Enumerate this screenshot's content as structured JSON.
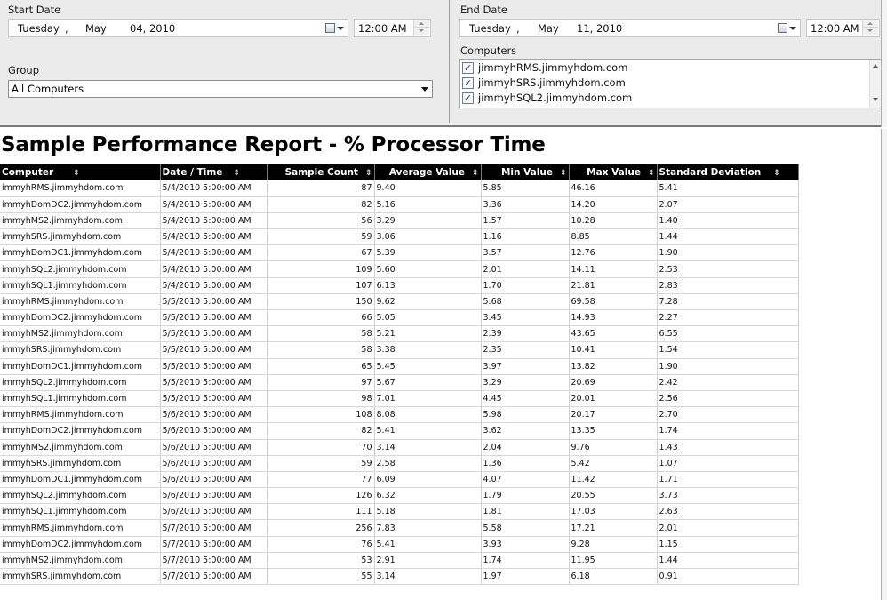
{
  "params": {
    "start_date": {
      "label": "Start Date",
      "day": "Tuesday",
      "sep": ",",
      "month": "May",
      "daynum_year": "04, 2010",
      "time": "12:00 AM"
    },
    "end_date": {
      "label": "End Date",
      "day": "Tuesday",
      "sep": ",",
      "month": "May",
      "daynum_year": "11, 2010",
      "time": "12:00 AM"
    },
    "group": {
      "label": "Group",
      "value": "All Computers"
    },
    "computers": {
      "label": "Computers",
      "items": [
        {
          "name": "jimmyhRMS.jimmyhdom.com",
          "checked": "✓"
        },
        {
          "name": "jimmyhSRS.jimmyhdom.com",
          "checked": "✓"
        },
        {
          "name": "jimmyhSQL2.jimmyhdom.com",
          "checked": "✓"
        }
      ]
    }
  },
  "report": {
    "title": "Sample Performance Report - % Processor Time",
    "columns": [
      "Computer",
      "Date / Time",
      "Sample Count",
      "Average Value",
      "Min Value",
      "Max Value",
      "Standard Deviation"
    ],
    "sort_glyph": "⇕",
    "rows": [
      [
        "immyhRMS.jimmyhdom.com",
        "5/4/2010 5:00:00 AM",
        "87",
        "9.40",
        "5.85",
        "46.16",
        "5.41"
      ],
      [
        "immyhDomDC2.jimmyhdom.com",
        "5/4/2010 5:00:00 AM",
        "82",
        "5.16",
        "3.36",
        "14.20",
        "2.07"
      ],
      [
        "immyhMS2.jimmyhdom.com",
        "5/4/2010 5:00:00 AM",
        "56",
        "3.29",
        "1.57",
        "10.28",
        "1.40"
      ],
      [
        "immyhSRS.jimmyhdom.com",
        "5/4/2010 5:00:00 AM",
        "59",
        "3.06",
        "1.16",
        "8.85",
        "1.44"
      ],
      [
        "immyhDomDC1.jimmyhdom.com",
        "5/4/2010 5:00:00 AM",
        "67",
        "5.39",
        "3.57",
        "12.76",
        "1.90"
      ],
      [
        "immyhSQL2.jimmyhdom.com",
        "5/4/2010 5:00:00 AM",
        "109",
        "5.60",
        "2.01",
        "14.11",
        "2.53"
      ],
      [
        "immyhSQL1.jimmyhdom.com",
        "5/4/2010 5:00:00 AM",
        "107",
        "6.13",
        "1.70",
        "21.81",
        "2.83"
      ],
      [
        "immyhRMS.jimmyhdom.com",
        "5/5/2010 5:00:00 AM",
        "150",
        "9.62",
        "5.68",
        "69.58",
        "7.28"
      ],
      [
        "immyhDomDC2.jimmyhdom.com",
        "5/5/2010 5:00:00 AM",
        "66",
        "5.05",
        "3.45",
        "14.93",
        "2.27"
      ],
      [
        "immyhMS2.jimmyhdom.com",
        "5/5/2010 5:00:00 AM",
        "58",
        "5.21",
        "2.39",
        "43.65",
        "6.55"
      ],
      [
        "immyhSRS.jimmyhdom.com",
        "5/5/2010 5:00:00 AM",
        "58",
        "3.38",
        "2.35",
        "10.41",
        "1.54"
      ],
      [
        "immyhDomDC1.jimmyhdom.com",
        "5/5/2010 5:00:00 AM",
        "65",
        "5.45",
        "3.97",
        "13.82",
        "1.90"
      ],
      [
        "immyhSQL2.jimmyhdom.com",
        "5/5/2010 5:00:00 AM",
        "97",
        "5.67",
        "3.29",
        "20.69",
        "2.42"
      ],
      [
        "immyhSQL1.jimmyhdom.com",
        "5/5/2010 5:00:00 AM",
        "98",
        "7.01",
        "4.45",
        "20.01",
        "2.56"
      ],
      [
        "immyhRMS.jimmyhdom.com",
        "5/6/2010 5:00:00 AM",
        "108",
        "8.08",
        "5.98",
        "20.17",
        "2.70"
      ],
      [
        "immyhDomDC2.jimmyhdom.com",
        "5/6/2010 5:00:00 AM",
        "82",
        "5.41",
        "3.62",
        "13.35",
        "1.74"
      ],
      [
        "immyhMS2.jimmyhdom.com",
        "5/6/2010 5:00:00 AM",
        "70",
        "3.14",
        "2.04",
        "9.76",
        "1.43"
      ],
      [
        "immyhSRS.jimmyhdom.com",
        "5/6/2010 5:00:00 AM",
        "59",
        "2.58",
        "1.36",
        "5.42",
        "1.07"
      ],
      [
        "immyhDomDC1.jimmyhdom.com",
        "5/6/2010 5:00:00 AM",
        "77",
        "6.09",
        "4.07",
        "11.42",
        "1.71"
      ],
      [
        "immyhSQL2.jimmyhdom.com",
        "5/6/2010 5:00:00 AM",
        "126",
        "6.32",
        "1.79",
        "20.55",
        "3.73"
      ],
      [
        "immyhSQL1.jimmyhdom.com",
        "5/6/2010 5:00:00 AM",
        "111",
        "5.18",
        "1.81",
        "17.03",
        "2.63"
      ],
      [
        "immyhRMS.jimmyhdom.com",
        "5/7/2010 5:00:00 AM",
        "256",
        "7.83",
        "5.58",
        "17.21",
        "2.01"
      ],
      [
        "immyhDomDC2.jimmyhdom.com",
        "5/7/2010 5:00:00 AM",
        "76",
        "5.41",
        "3.93",
        "9.28",
        "1.15"
      ],
      [
        "immyhMS2.jimmyhdom.com",
        "5/7/2010 5:00:00 AM",
        "53",
        "2.91",
        "1.74",
        "11.95",
        "1.44"
      ],
      [
        "immyhSRS.jimmyhdom.com",
        "5/7/2010 5:00:00 AM",
        "55",
        "3.14",
        "1.97",
        "6.18",
        "0.91"
      ]
    ]
  }
}
